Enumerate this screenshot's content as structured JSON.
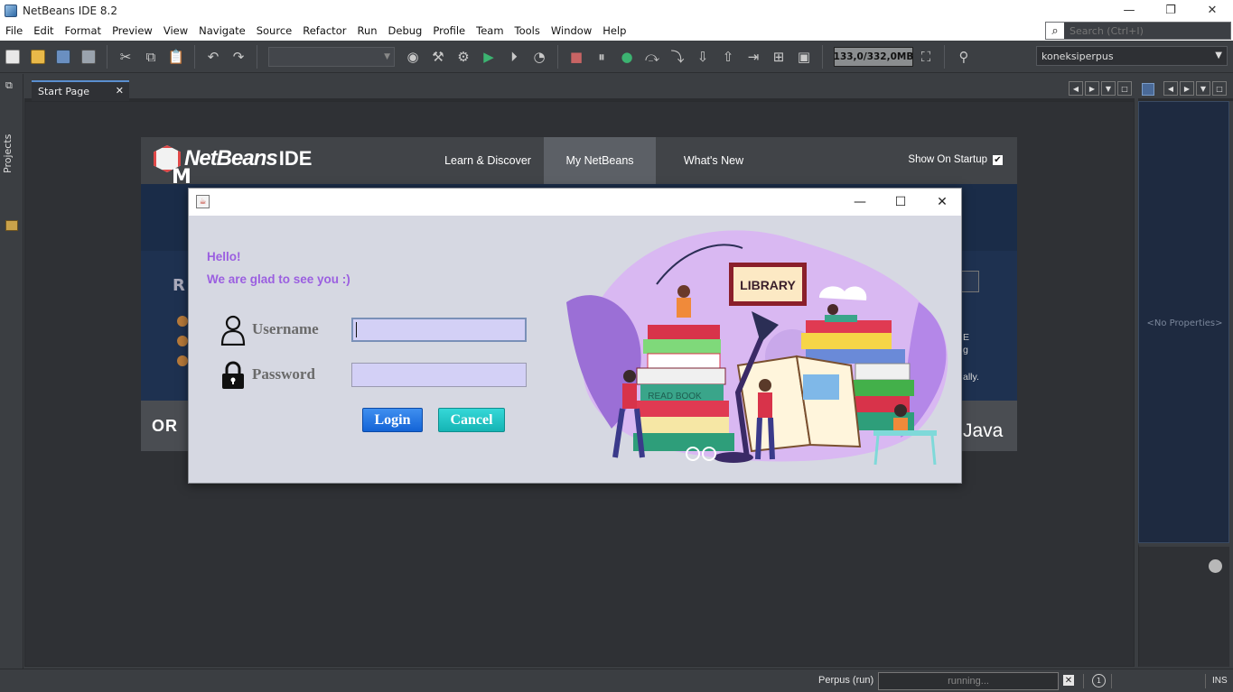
{
  "window": {
    "title": "NetBeans IDE 8.2",
    "controls": {
      "minimize": "—",
      "restore": "❐",
      "close": "✕"
    }
  },
  "menubar": {
    "items": [
      "File",
      "Edit",
      "Format",
      "Preview",
      "View",
      "Navigate",
      "Source",
      "Refactor",
      "Run",
      "Debug",
      "Profile",
      "Team",
      "Tools",
      "Window",
      "Help"
    ]
  },
  "search": {
    "placeholder": "Search (Ctrl+I)",
    "icon": "search-icon"
  },
  "toolbar": {
    "memory": "133,0/332,0MB",
    "project_config": "koneksiperpus"
  },
  "left_strip": {
    "projects_tab": "Projects"
  },
  "editor_tabs": {
    "start_page": "Start Page",
    "close": "✕"
  },
  "start_page": {
    "nav": {
      "learn": "Learn & Discover",
      "mynetbeans": "My NetBeans",
      "whats_new": "What's New"
    },
    "logo_text": "NetBeans",
    "logo_ide": "IDE",
    "show_on_startup": "Show On Startup",
    "show_on_startup_checked": "✔",
    "banner_letter": "M",
    "recent_letter": "R",
    "right_text_1": "E",
    "right_text_2": "g",
    "right_text_3": "ally.",
    "oracle_partial": "OR",
    "java": "Java"
  },
  "right_panel": {
    "no_properties": "<No Properties>"
  },
  "statusbar": {
    "task": "Perpus (run)",
    "progress": "running...",
    "cancel": "✕",
    "notifications": "1",
    "mode": "INS"
  },
  "login_dialog": {
    "title_icon": "java-icon",
    "greeting_line1": "Hello!",
    "greeting_line2": "We are glad to see you :)",
    "username_label": "Username",
    "password_label": "Password",
    "username_value": "",
    "password_value": "",
    "login_button": "Login",
    "cancel_button": "Cancel",
    "illustration_sign": "LIBRARY",
    "illustration_book_text": "READ BOOK",
    "colors": {
      "greeting": "#9b5fe0",
      "login": "#1d6fe0",
      "cancel": "#1cc4c4",
      "input_bg": "#d3d0f6"
    }
  }
}
